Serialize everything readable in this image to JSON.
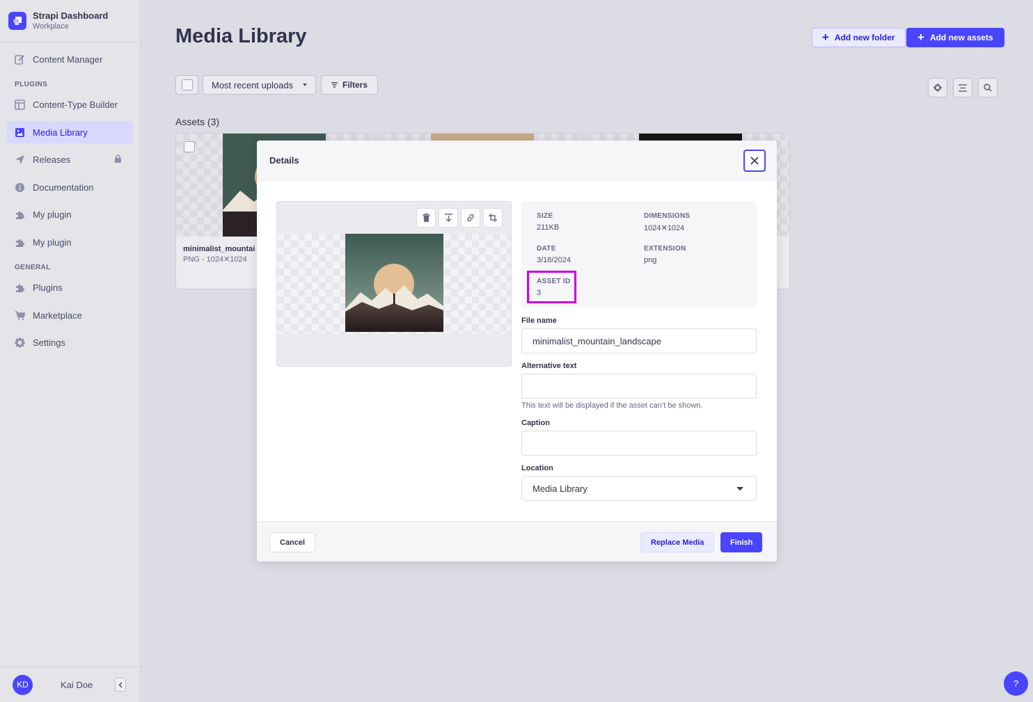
{
  "brand": {
    "title": "Strapi Dashboard",
    "subtitle": "Workplace"
  },
  "sidebar": {
    "items": [
      {
        "label": "Content Manager",
        "icon": "pencil-icon"
      }
    ],
    "plugins_label": "PLUGINS",
    "plugins": [
      {
        "label": "Content-Type Builder",
        "icon": "layout-icon"
      },
      {
        "label": "Media Library",
        "icon": "image-icon",
        "active": true
      },
      {
        "label": "Releases",
        "icon": "paper-plane-icon",
        "locked": true
      },
      {
        "label": "Documentation",
        "icon": "info-icon"
      },
      {
        "label": "My plugin",
        "icon": "puzzle-icon"
      },
      {
        "label": "My plugin",
        "icon": "puzzle-icon"
      }
    ],
    "general_label": "GENERAL",
    "general": [
      {
        "label": "Plugins",
        "icon": "puzzle-icon"
      },
      {
        "label": "Marketplace",
        "icon": "cart-icon"
      },
      {
        "label": "Settings",
        "icon": "gear-icon"
      }
    ],
    "user": {
      "initials": "KD",
      "name": "Kai Doe"
    }
  },
  "header": {
    "title": "Media Library",
    "add_folder": "Add new folder",
    "add_assets": "Add new assets"
  },
  "toolbar": {
    "sort": "Most recent uploads",
    "filters": "Filters"
  },
  "assets": {
    "title": "Assets (3)",
    "cards": [
      {
        "name": "minimalist_mountai",
        "meta": "PNG - 1024✕1024"
      }
    ]
  },
  "modal": {
    "title": "Details",
    "meta": {
      "size_label": "SIZE",
      "size": "211KB",
      "dimensions_label": "DIMENSIONS",
      "dimensions": "1024✕1024",
      "date_label": "DATE",
      "date": "3/18/2024",
      "extension_label": "EXTENSION",
      "extension": "png",
      "asset_id_label": "ASSET ID",
      "asset_id": "3"
    },
    "file_name_label": "File name",
    "file_name": "minimalist_mountain_landscape",
    "alt_label": "Alternative text",
    "alt_value": "",
    "alt_hint": "This text will be displayed if the asset can’t be shown.",
    "caption_label": "Caption",
    "caption_value": "",
    "location_label": "Location",
    "location": "Media Library",
    "cancel": "Cancel",
    "replace": "Replace Media",
    "finish": "Finish"
  },
  "help": "?",
  "colors": {
    "primary": "#4945ff",
    "highlight": "#c500e6"
  }
}
